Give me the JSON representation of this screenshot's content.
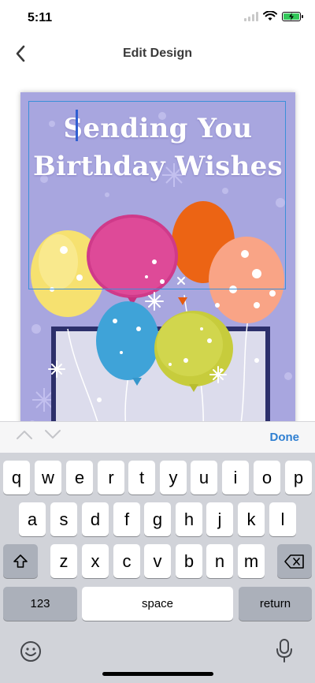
{
  "status": {
    "time": "5:11"
  },
  "nav": {
    "title": "Edit Design"
  },
  "card": {
    "line1": "Sending You",
    "line2": "Birthday Wishes",
    "background_color": "#a8a6df"
  },
  "toolbar": {
    "done_label": "Done"
  },
  "keyboard": {
    "row1": [
      "q",
      "w",
      "e",
      "r",
      "t",
      "y",
      "u",
      "i",
      "o",
      "p"
    ],
    "row2": [
      "a",
      "s",
      "d",
      "f",
      "g",
      "h",
      "j",
      "k",
      "l"
    ],
    "row3": [
      "z",
      "x",
      "c",
      "v",
      "b",
      "n",
      "m"
    ],
    "numbers_label": "123",
    "space_label": "space",
    "return_label": "return"
  },
  "icons": [
    "back-chevron-icon",
    "wifi-icon",
    "battery-charging-icon",
    "chevron-up-icon",
    "chevron-down-icon",
    "shift-icon",
    "backspace-icon",
    "emoji-icon",
    "microphone-icon"
  ],
  "colors": {
    "accent": "#2f7fd1",
    "selection": "#3b8fd9"
  }
}
